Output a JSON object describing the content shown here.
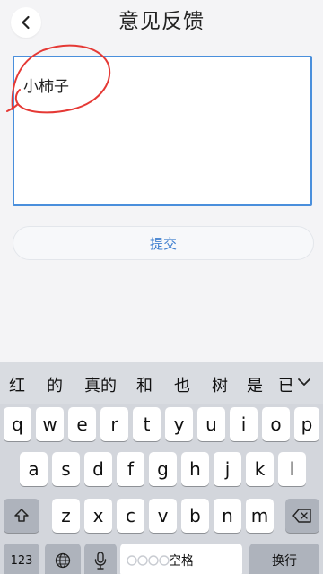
{
  "header": {
    "title": "意见反馈",
    "back_icon": "chevron-left-icon"
  },
  "feedback": {
    "text": "小柿子"
  },
  "submit": {
    "label": "提交"
  },
  "keyboard": {
    "candidates": [
      "红",
      "的",
      "真的",
      "和",
      "也",
      "树",
      "是",
      "已"
    ],
    "row1": [
      "q",
      "w",
      "e",
      "r",
      "t",
      "y",
      "u",
      "i",
      "o",
      "p"
    ],
    "row2": [
      "a",
      "s",
      "d",
      "f",
      "g",
      "h",
      "j",
      "k",
      "l"
    ],
    "row3": [
      "z",
      "x",
      "c",
      "v",
      "b",
      "n",
      "m"
    ],
    "numbers_label": "123",
    "space_label": "空格",
    "return_label": "换行",
    "icons": {
      "shift": "shift-icon",
      "delete": "backspace-icon",
      "globe": "globe-icon",
      "mic": "microphone-icon",
      "expand": "chevron-down-icon"
    }
  },
  "colors": {
    "accent": "#3f7fcf",
    "input_border": "#4a8fdc",
    "annotation": "#e53935"
  }
}
